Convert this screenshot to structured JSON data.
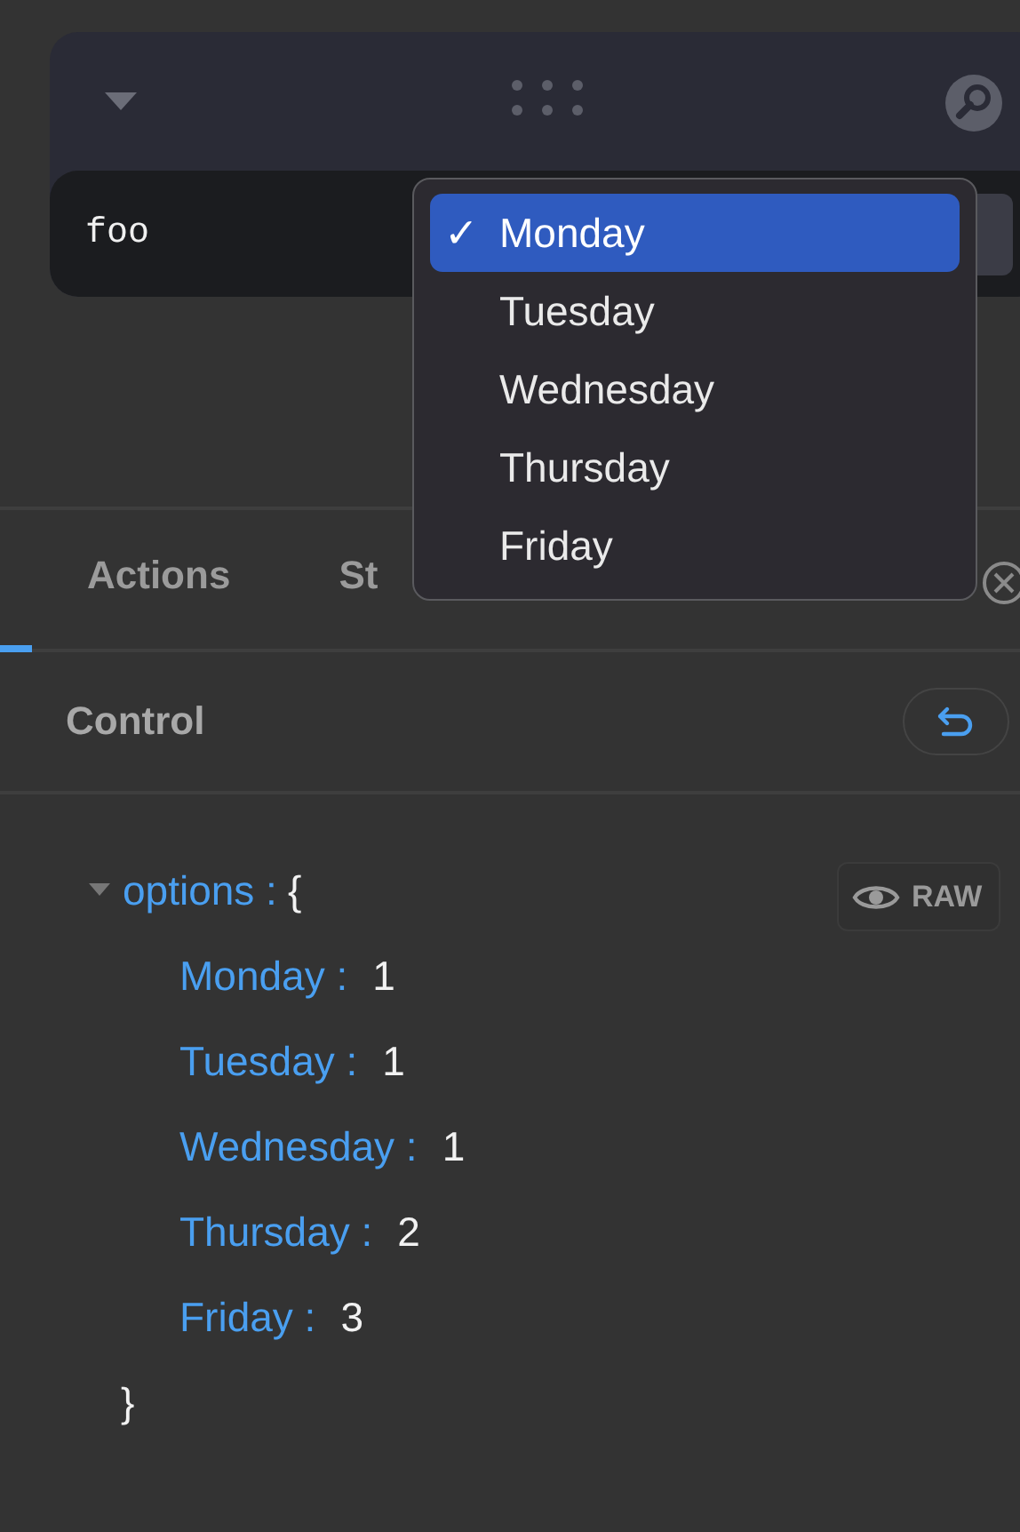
{
  "widget": {
    "field_value": "foo"
  },
  "dropdown": {
    "items": [
      {
        "label": "Monday",
        "selected": true,
        "check": "✓"
      },
      {
        "label": "Tuesday",
        "selected": false
      },
      {
        "label": "Wednesday",
        "selected": false
      },
      {
        "label": "Thursday",
        "selected": false
      },
      {
        "label": "Friday",
        "selected": false
      }
    ]
  },
  "tabs": [
    {
      "label": "Actions",
      "selected": false
    },
    {
      "label": "St",
      "selected": false
    }
  ],
  "panel": {
    "title": "Control",
    "raw_label": "RAW"
  },
  "tree": {
    "key": "options :",
    "open": "{",
    "close": "}",
    "expanded": true,
    "children": [
      {
        "key": "Monday :",
        "value": "1"
      },
      {
        "key": "Tuesday :",
        "value": "1"
      },
      {
        "key": "Wednesday :",
        "value": "1"
      },
      {
        "key": "Thursday :",
        "value": "2"
      },
      {
        "key": "Friday :",
        "value": "3"
      }
    ]
  }
}
